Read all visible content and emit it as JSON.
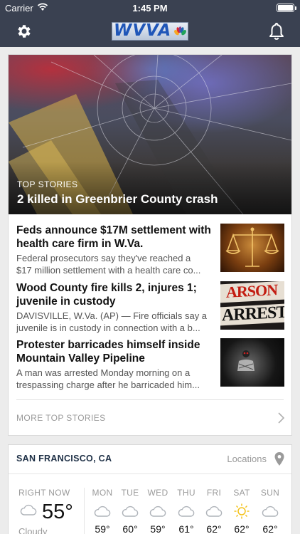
{
  "status_bar": {
    "carrier": "Carrier",
    "time": "1:45 PM",
    "wifi_icon": "wifi-icon",
    "battery_icon": "battery-icon"
  },
  "nav": {
    "logo_text": "WVVA",
    "settings_icon": "gear-icon",
    "alerts_icon": "bell-icon",
    "color": "#3a4151"
  },
  "top_story": {
    "kicker": "TOP STORIES",
    "headline": "2 killed in Greenbrier County crash"
  },
  "stories": [
    {
      "title": "Feds announce $17M settlement with health care firm in W.Va.",
      "summary": [
        "Federal prosecutors say they've reached a",
        "$17 million settlement with a health care co..."
      ],
      "thumb": "scales-of-justice-image"
    },
    {
      "title": "Wood County fire kills 2, injures 1; juvenile in custody",
      "summary": [
        "DAVISVILLE, W.Va. (AP) — Fire officials say a",
        "juvenile is in custody in connection with a b..."
      ],
      "thumb": "arson-arrest-image",
      "thumb_text": [
        "ARSON",
        "ARREST"
      ]
    },
    {
      "title": "Protester barricades himself inside Mountain Valley Pipeline",
      "summary": [
        "A man was arrested Monday morning on a",
        "trespassing charge after he barricaded him..."
      ],
      "thumb": "pipeline-image"
    }
  ],
  "more_link": "MORE TOP STORIES",
  "weather": {
    "city": "SAN FRANCISCO, CA",
    "locations_label": "Locations",
    "now_label": "RIGHT NOW",
    "now_temp": "55°",
    "now_condition": "Cloudy",
    "days": [
      {
        "name": "MON",
        "icon": "cloud-icon",
        "temp": "59°"
      },
      {
        "name": "TUE",
        "icon": "cloud-icon",
        "temp": "60°"
      },
      {
        "name": "WED",
        "icon": "cloud-icon",
        "temp": "59°"
      },
      {
        "name": "THU",
        "icon": "cloud-icon",
        "temp": "61°"
      },
      {
        "name": "FRI",
        "icon": "cloud-icon",
        "temp": "62°"
      },
      {
        "name": "SAT",
        "icon": "sun-icon",
        "temp": "62°"
      },
      {
        "name": "SUN",
        "icon": "cloud-icon",
        "temp": "62°"
      }
    ]
  }
}
